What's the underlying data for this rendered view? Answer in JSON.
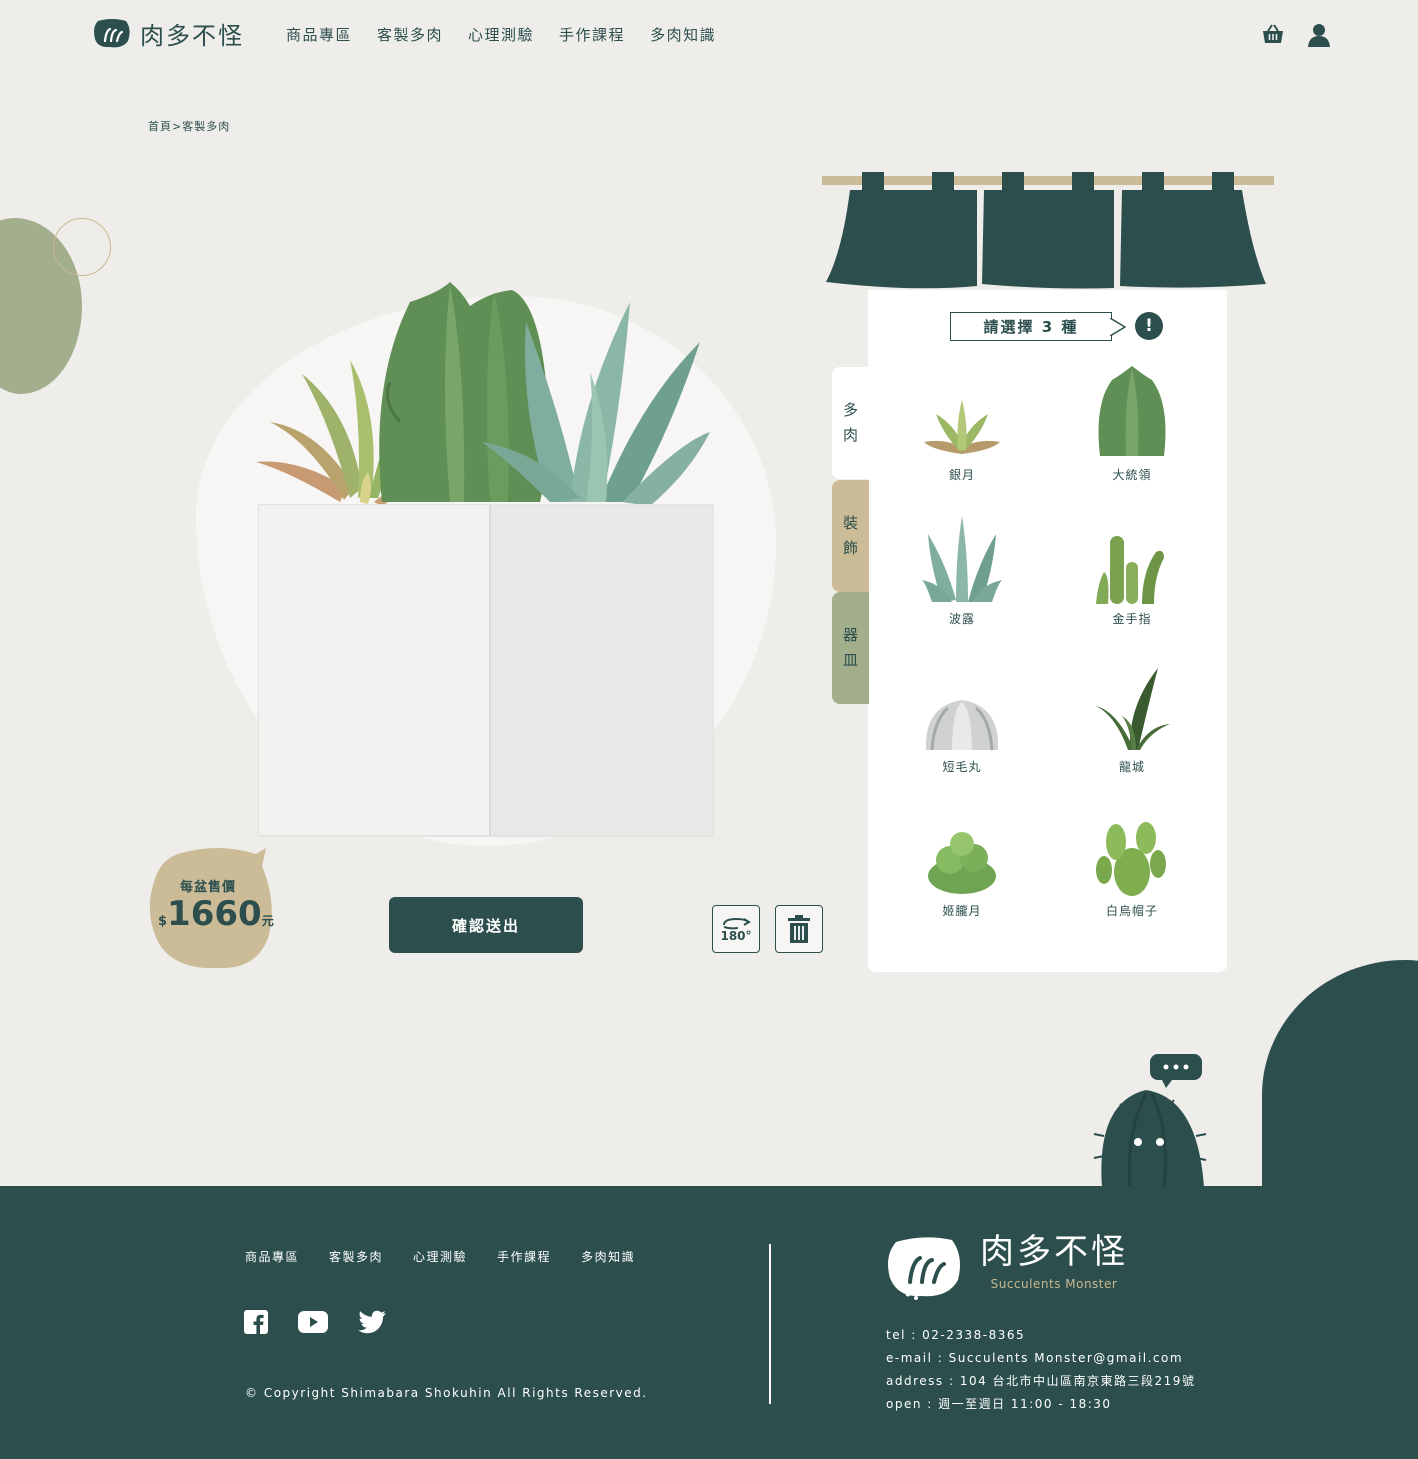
{
  "header": {
    "brand": "肉多不怪",
    "nav": [
      "商品專區",
      "客製多肉",
      "心理測驗",
      "手作課程",
      "多肉知識"
    ],
    "icons": [
      "cart-icon",
      "user-icon"
    ]
  },
  "breadcrumb": "首頁>客製多肉",
  "price": {
    "label": "每盆售價",
    "currency": "$",
    "amount": "1660",
    "unit": "元"
  },
  "actions": {
    "confirm": "確認送出",
    "rotate": "180°"
  },
  "panel": {
    "hint": "請選擇 3 種",
    "alert": "!",
    "tabs": [
      {
        "c1": "多",
        "c2": "肉"
      },
      {
        "c1": "裝",
        "c2": "飾"
      },
      {
        "c1": "器",
        "c2": "皿"
      }
    ],
    "plants": [
      "銀月",
      "大統領",
      "波露",
      "金手指",
      "短毛丸",
      "龍城",
      "姬朧月",
      "白烏帽子"
    ]
  },
  "footer": {
    "nav": [
      "商品專區",
      "客製多肉",
      "心理測驗",
      "手作課程",
      "多肉知識"
    ],
    "social": [
      "facebook-icon",
      "youtube-icon",
      "twitter-icon"
    ],
    "copyright": "© Copyright Shimabara Shokuhin All Rights Reserved.",
    "brand": "肉多不怪",
    "brand_en": "Succulents Monster",
    "tel": "tel : 02-2338-8365",
    "email": "e-mail : Succulents Monster@gmail.com",
    "address": "address : 104 台北市中山區南京東路三段219號",
    "open": "open : 週一至週日 11:00 - 18:30"
  },
  "colors": {
    "primary": "#2c4f4e",
    "sage": "#a2ae8c",
    "sand": "#cbbb96",
    "background": "#efedea"
  }
}
